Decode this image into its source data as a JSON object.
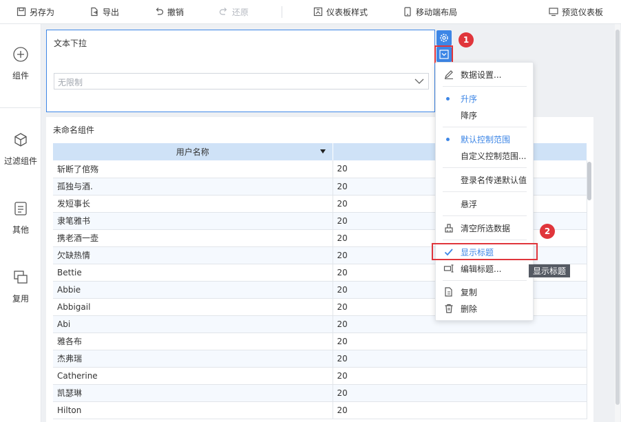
{
  "toolbar": {
    "save_as": "另存为",
    "export": "导出",
    "undo": "撤销",
    "redo": "还原",
    "dashboard_style": "仪表板样式",
    "mobile_layout": "移动端布局",
    "preview": "预览仪表板"
  },
  "sidebar": {
    "items": [
      {
        "label": "组件",
        "icon": "plus-circle-icon"
      },
      {
        "label": "过滤组件",
        "icon": "cube-icon"
      },
      {
        "label": "其他",
        "icon": "document-icon"
      },
      {
        "label": "复用",
        "icon": "reuse-icon"
      }
    ]
  },
  "filter_widget": {
    "title": "文本下拉",
    "placeholder": "无限制"
  },
  "badges": {
    "first": "1",
    "second": "2"
  },
  "table_widget": {
    "title": "未命名组件",
    "columns": [
      "用户名称",
      ""
    ],
    "rows": [
      [
        "斩断了倌殇",
        "20"
      ],
      [
        "孤独与酒.",
        "20"
      ],
      [
        "发短事长",
        "20"
      ],
      [
        "隶笔雅书",
        "20"
      ],
      [
        "携老酒一壶",
        "20"
      ],
      [
        "欠缺热情",
        "20"
      ],
      [
        "Bettie",
        "20"
      ],
      [
        "Abbie",
        "20"
      ],
      [
        "Abbigail",
        "20"
      ],
      [
        "Abi",
        "20"
      ],
      [
        "雅各布",
        "20"
      ],
      [
        "杰弗瑞",
        "20"
      ],
      [
        "Catherine",
        "20"
      ],
      [
        "凯瑟琳",
        "20"
      ],
      [
        "Hilton",
        "20"
      ]
    ]
  },
  "menu": {
    "data_settings": "数据设置...",
    "ascending": "升序",
    "descending": "降序",
    "default_range": "默认控制范围",
    "custom_range": "自定义控制范围...",
    "login_default": "登录名传递默认值",
    "float": "悬浮",
    "clear_selection": "清空所选数据",
    "show_title": "显示标题",
    "edit_title": "编辑标题...",
    "copy": "复制",
    "delete": "删除"
  },
  "tooltip": "显示标题",
  "colors": {
    "accent": "#3d86e6",
    "highlight": "#e0353b",
    "header_bg": "#cfe2f7"
  }
}
